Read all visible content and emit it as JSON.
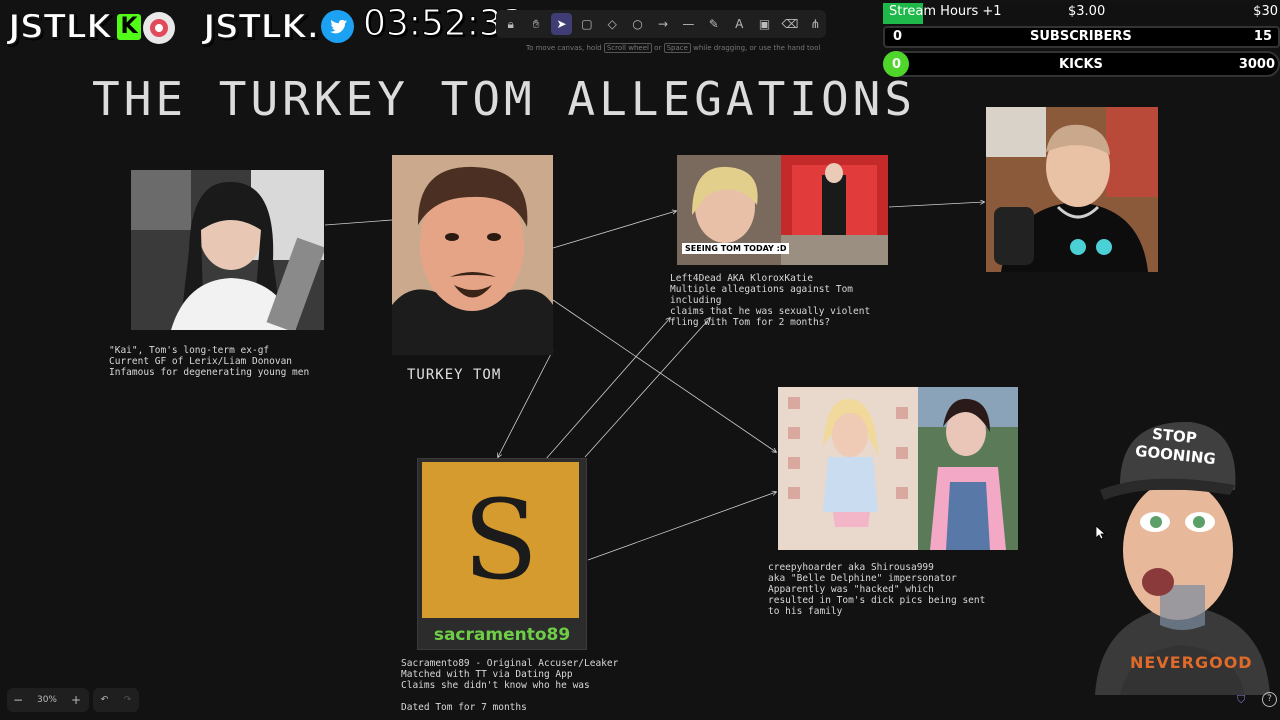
{
  "overlay": {
    "logo_left": "JSTLK",
    "kick_letter": "K",
    "logo_right": "JSTLK.",
    "timer": "03:52:33"
  },
  "toolbar": {
    "hint": "To move canvas, hold [Scroll wheel] or [Space] while dragging, or use the hand tool",
    "hint_key1": "Scroll wheel",
    "hint_key2": "Space"
  },
  "goals": {
    "stream_hours_label": "Stream Hours +1",
    "stream_hours_amount": "$3.00",
    "stream_hours_goal": "$30",
    "subscribers_current": "0",
    "subscribers_label": "SUBSCRIBERS",
    "subscribers_goal": "15",
    "kicks_current": "0",
    "kicks_label": "KICKS",
    "kicks_goal": "3000"
  },
  "board": {
    "title": "THE TURKEY TOM ALLEGATIONS",
    "kai_note": "\"Kai\", Tom's long-term ex-gf\nCurrent GF of Lerix/Liam Donovan\nInfamous for degenerating young men",
    "tom_label": "TURKEY TOM",
    "katie_caption": "SEEING TOM TODAY :D",
    "katie_note": "Left4Dead AKA KloroxKatie\nMultiple allegations against Tom including\nclaims that he was sexually violent\nfling with Tom for 2 months?",
    "sacramento_letter": "S",
    "sacramento_name": "sacramento89",
    "sacramento_note": "Sacramento89 - Original Accuser/Leaker\nMatched with TT via Dating App\nClaims she didn't know who he was\n\nDated Tom for 7 months",
    "creepy_note": "creepyhoarder aka Shirousa999\naka \"Belle Delphine\" impersonator\nApparently was \"hacked\" which\nresulted in Tom's dick pics being sent\nto his family"
  },
  "mascot": {
    "hat_line1": "STOP",
    "hat_line2": "GOONING",
    "shirt_text": "NEVERGOOD"
  },
  "zoom": {
    "minus": "−",
    "level": "30%",
    "plus": "+"
  },
  "colors": {
    "kick_green": "#53fc18",
    "twitter_blue": "#1da1f2",
    "sacramento_bg": "#d59b2e",
    "toolbar_active": "#403d74"
  }
}
